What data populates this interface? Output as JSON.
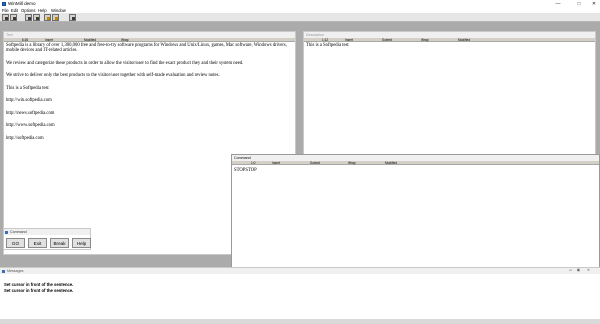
{
  "app": {
    "title": "WinMill demo"
  },
  "window_controls": {
    "minimize": "—",
    "maximize": "□",
    "close": "✕"
  },
  "menu": [
    "File",
    "Edit",
    "Options",
    "Help",
    "Window"
  ],
  "toolbar": {
    "icons": [
      "open-icon",
      "save-icon",
      "cut-icon",
      "copy-icon",
      "settings-icon",
      "stop-icon",
      "help-icon"
    ]
  },
  "text_window": {
    "title": "Text",
    "status": {
      "pos": "6:26",
      "mode": "Insert",
      "modified": "Modified",
      "wrap": "Wrap"
    },
    "paragraphs": [
      "Softpedia is a library of over 1,300,000 free and free-to-try software programs for Windows and Unix/Linux, games, Mac software, Windows drivers, mobile devices and IT-related articles.",
      "We review and categorize these products in order to allow the visitor/user to find the exact product they and their system need.",
      "We strive to deliver only the best products to the visitor/user together with self-made evaluation and review notes.",
      "This is a Softpedia test",
      "http://win.softpedia.com",
      "http://news.softpedia.com",
      "http://www.softpedia.com",
      "http://softpedia.com"
    ]
  },
  "description_window": {
    "title": "Description",
    "status": {
      "pos": "1:12",
      "mode": "Insert",
      "submit": "Submit",
      "wrap": "Wrap",
      "modified": "Modified"
    },
    "text": "This is a Softpedia test"
  },
  "command_window": {
    "title": "Command",
    "status": {
      "pos": "1:0",
      "mode": "Insert",
      "submit": "Submit",
      "wrap": "Wrap",
      "modified": "Modified"
    },
    "text": "STOPSTOP"
  },
  "command_panel": {
    "title": "Command",
    "buttons": {
      "go": "GO",
      "exit": "Exit",
      "break": "Break",
      "help": "Help"
    }
  },
  "messages_window": {
    "title": "Messages",
    "lines": [
      "Set cursor in front of the sentence.",
      "Set cursor in front of the sentence."
    ]
  },
  "colors": {
    "desktop": "#ababab",
    "status_bar": "#d4d0c8",
    "window_bg": "#ffffff"
  }
}
